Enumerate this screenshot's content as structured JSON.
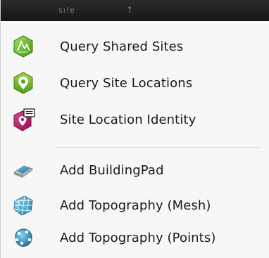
{
  "header": {
    "label": "sı!ɐ",
    "arrow": "↑"
  },
  "groups": {
    "site": [
      {
        "label": "Query Shared Sites",
        "icon": "shared-sites-icon"
      },
      {
        "label": "Query Site Locations",
        "icon": "site-location-icon"
      },
      {
        "label": "Site Location Identity",
        "icon": "site-identity-icon"
      }
    ],
    "topography": [
      {
        "label": "Add BuildingPad",
        "icon": "building-pad-icon"
      },
      {
        "label": "Add Topography (Mesh)",
        "icon": "topography-mesh-icon"
      },
      {
        "label": "Add Topography (Points)",
        "icon": "topography-points-icon"
      }
    ]
  },
  "colors": {
    "header_bg": "#1e1e1e",
    "menu_bg": "#f7f7f7",
    "green": "#6cbf2c",
    "magenta": "#b0156b",
    "teal": "#2a8fb0"
  }
}
